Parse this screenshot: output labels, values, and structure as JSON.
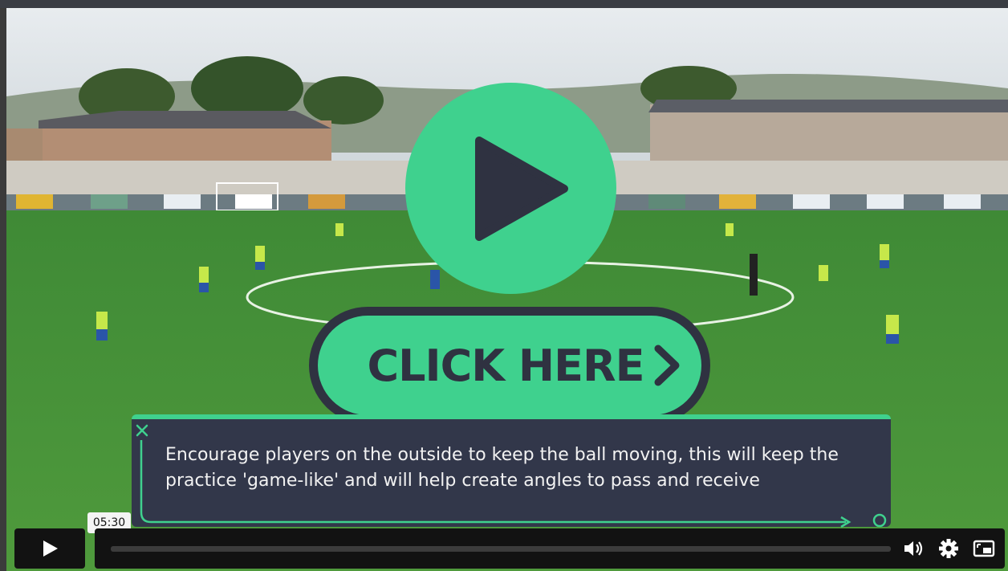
{
  "player": {
    "big_play_label": "Play video",
    "cta_label": "CLICK HERE",
    "tip_text": "Encourage players on the outside to keep the ball moving, this will keep the practice 'game-like' and will help create angles to pass and receive",
    "timestamp": "05:30",
    "progress_fraction": 0.0,
    "accent_color": "#3fd18e",
    "dark_color": "#2f3241",
    "icons": [
      "play-icon",
      "chevron-right-icon",
      "close-icon",
      "volume-icon",
      "gear-icon",
      "picture-in-picture-icon"
    ]
  }
}
